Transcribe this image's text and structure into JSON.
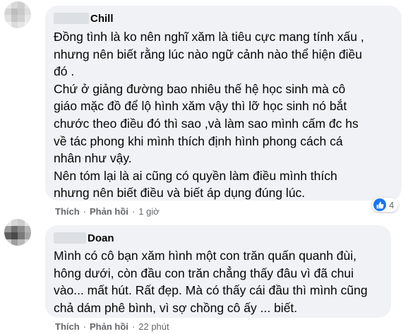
{
  "comments": [
    {
      "author": "Chill",
      "text": "Đồng tình là ko nên nghĩ xăm là tiêu cực mang tính xấu ,\nnhưng nên biết rằng lúc nào ngữ cảnh nào thể hiện điều\nđó .\nChứ ở giảng đường bao nhiêu thế hệ học sinh mà cô\ngiáo mặc đồ để lộ hình xăm vậy thì lỡ học sinh nó bắt\nchước theo điều đó thì sao ,và làm sao mình cấm đc hs\nvề tác phong khi mình thích định hình phong cách cá\nnhân như vậy.\nNên tóm lại là ai cũng có quyền làm điều mình thích\nnhưng nên biết điều và biết áp dụng đúng lúc.",
      "like_label": "Thích",
      "reply_label": "Phản hồi",
      "separator": "·",
      "time": "1 giờ",
      "reaction_count": "4",
      "reaction_icon": "like-icon"
    },
    {
      "author": "Doan",
      "text": "Mình có cô bạn xăm hình một con trăn quấn quanh đùi,\nhông dưới, còn đầu con trăn chẳng thấy đâu vì đã chui\nvào... mất hút. Rất đẹp. Mà có thấy cái đầu thì mình cũng\nchả dám phê bình, vì sợ chồng cô ấy ... biết.",
      "like_label": "Thích",
      "reply_label": "Phản hồi",
      "separator": "·",
      "time": "22 phút"
    }
  ],
  "colors": {
    "bubble": "#f0f2f5",
    "meta_text": "#65676b",
    "like_blue": "#1877f2"
  }
}
